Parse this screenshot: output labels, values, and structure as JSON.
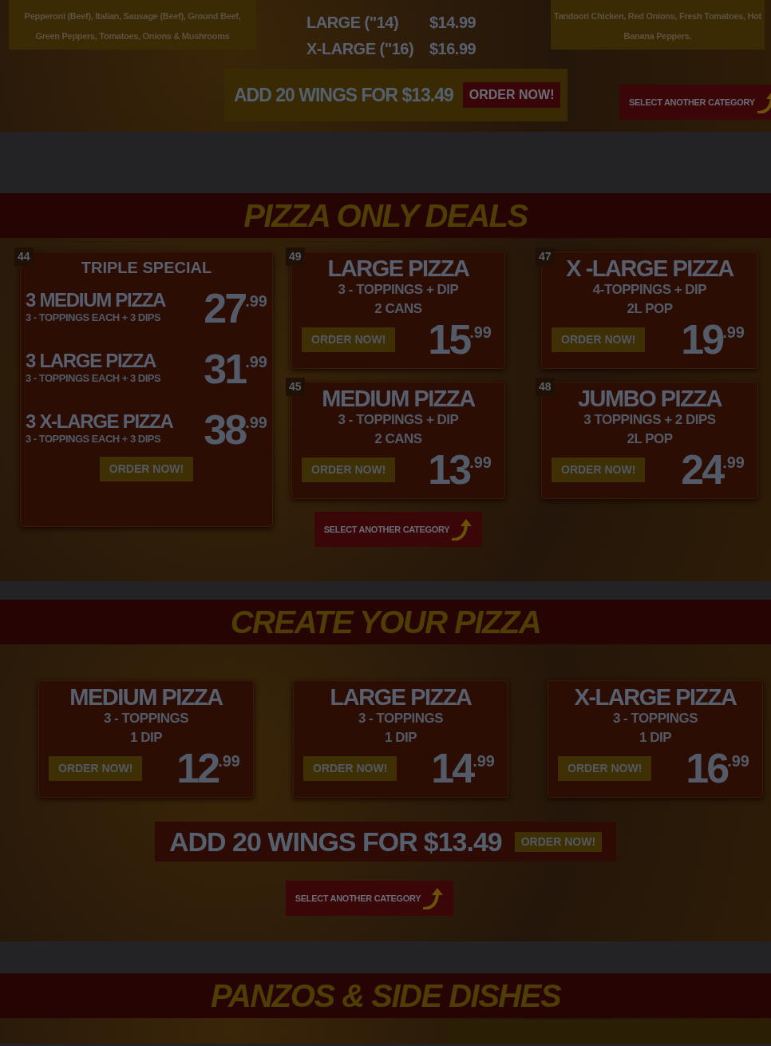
{
  "top": {
    "combos": [
      {
        "description": "Pepperoni (Beef), Italian, Sausage (Beef), Ground Beef, Green Peppers, Tomatoes, Onions & Mushrooms"
      },
      {
        "description": "Tandoori Chicken, Red Onions, Fresh Tomatoes, Hot Banana Peppers."
      }
    ],
    "sizes": [
      {
        "size": "LARGE (\"14)",
        "price": "$14.99"
      },
      {
        "size": "X-LARGE (\"16)",
        "price": "$16.99"
      }
    ],
    "wings": {
      "text": "ADD 20 WINGS FOR $13.49",
      "button": "ORDER NOW!"
    },
    "select_button": "SELECT ANOTHER CATEGORY"
  },
  "deals_section": {
    "title": "PIZZA ONLY DEALS",
    "triple": {
      "number": "44",
      "title": "TRIPLE SPECIAL",
      "items": [
        {
          "name": "3 MEDIUM PIZZA",
          "details": "3 - TOPPINGS EACH + 3 DIPS",
          "price": "27",
          "cents": ".99"
        },
        {
          "name": "3 LARGE PIZZA",
          "details": "3 - TOPPINGS EACH + 3 DIPS",
          "price": "31",
          "cents": ".99"
        },
        {
          "name": "3 X-LARGE PIZZA",
          "details": "3 - TOPPINGS EACH + 3 DIPS",
          "price": "38",
          "cents": ".99"
        }
      ],
      "button": "ORDER NOW!"
    },
    "columns": [
      {
        "deals": [
          {
            "number": "49",
            "name": "LARGE PIZZA",
            "lines": [
              "3 - TOPPINGS + DIP",
              "2 CANS"
            ],
            "button": "ORDER NOW!",
            "price": "15",
            "cents": ".99"
          },
          {
            "number": "45",
            "name": "MEDIUM PIZZA",
            "lines": [
              "3 - TOPPINGS + DIP",
              "2 CANS"
            ],
            "button": "ORDER NOW!",
            "price": "13",
            "cents": ".99"
          }
        ],
        "select_button": "SELECT ANOTHER CATEGORY"
      },
      {
        "deals": [
          {
            "number": "47",
            "name": "X -LARGE PIZZA",
            "lines": [
              "4-TOPPINGS + DIP",
              "2L POP"
            ],
            "button": "ORDER NOW!",
            "price": "19",
            "cents": ".99"
          },
          {
            "number": "48",
            "name": "JUMBO PIZZA",
            "lines": [
              "3 TOPPINGS + 2 DIPS",
              "2L POP"
            ],
            "button": "ORDER NOW!",
            "price": "24",
            "cents": ".99"
          }
        ]
      }
    ]
  },
  "create_section": {
    "title": "CREATE YOUR PIZZA",
    "pizzas": [
      {
        "name": "MEDIUM PIZZA",
        "lines": [
          "3 - TOPPINGS",
          "1 DIP"
        ],
        "button": "ORDER NOW!",
        "price": "12",
        "cents": ".99"
      },
      {
        "name": "LARGE PIZZA",
        "lines": [
          "3 - TOPPINGS",
          "1 DIP"
        ],
        "button": "ORDER NOW!",
        "price": "14",
        "cents": ".99"
      },
      {
        "name": "X-LARGE PIZZA",
        "lines": [
          "3 - TOPPINGS",
          "1 DIP"
        ],
        "button": "ORDER NOW!",
        "price": "16",
        "cents": ".99"
      }
    ],
    "wings": {
      "text": "ADD 20 WINGS FOR",
      "price": "$13.49",
      "button": "ORDER NOW!"
    },
    "select_button": "SELECT ANOTHER CATEGORY"
  },
  "sides_section": {
    "title": "PANZOS & SIDE DISHES"
  }
}
